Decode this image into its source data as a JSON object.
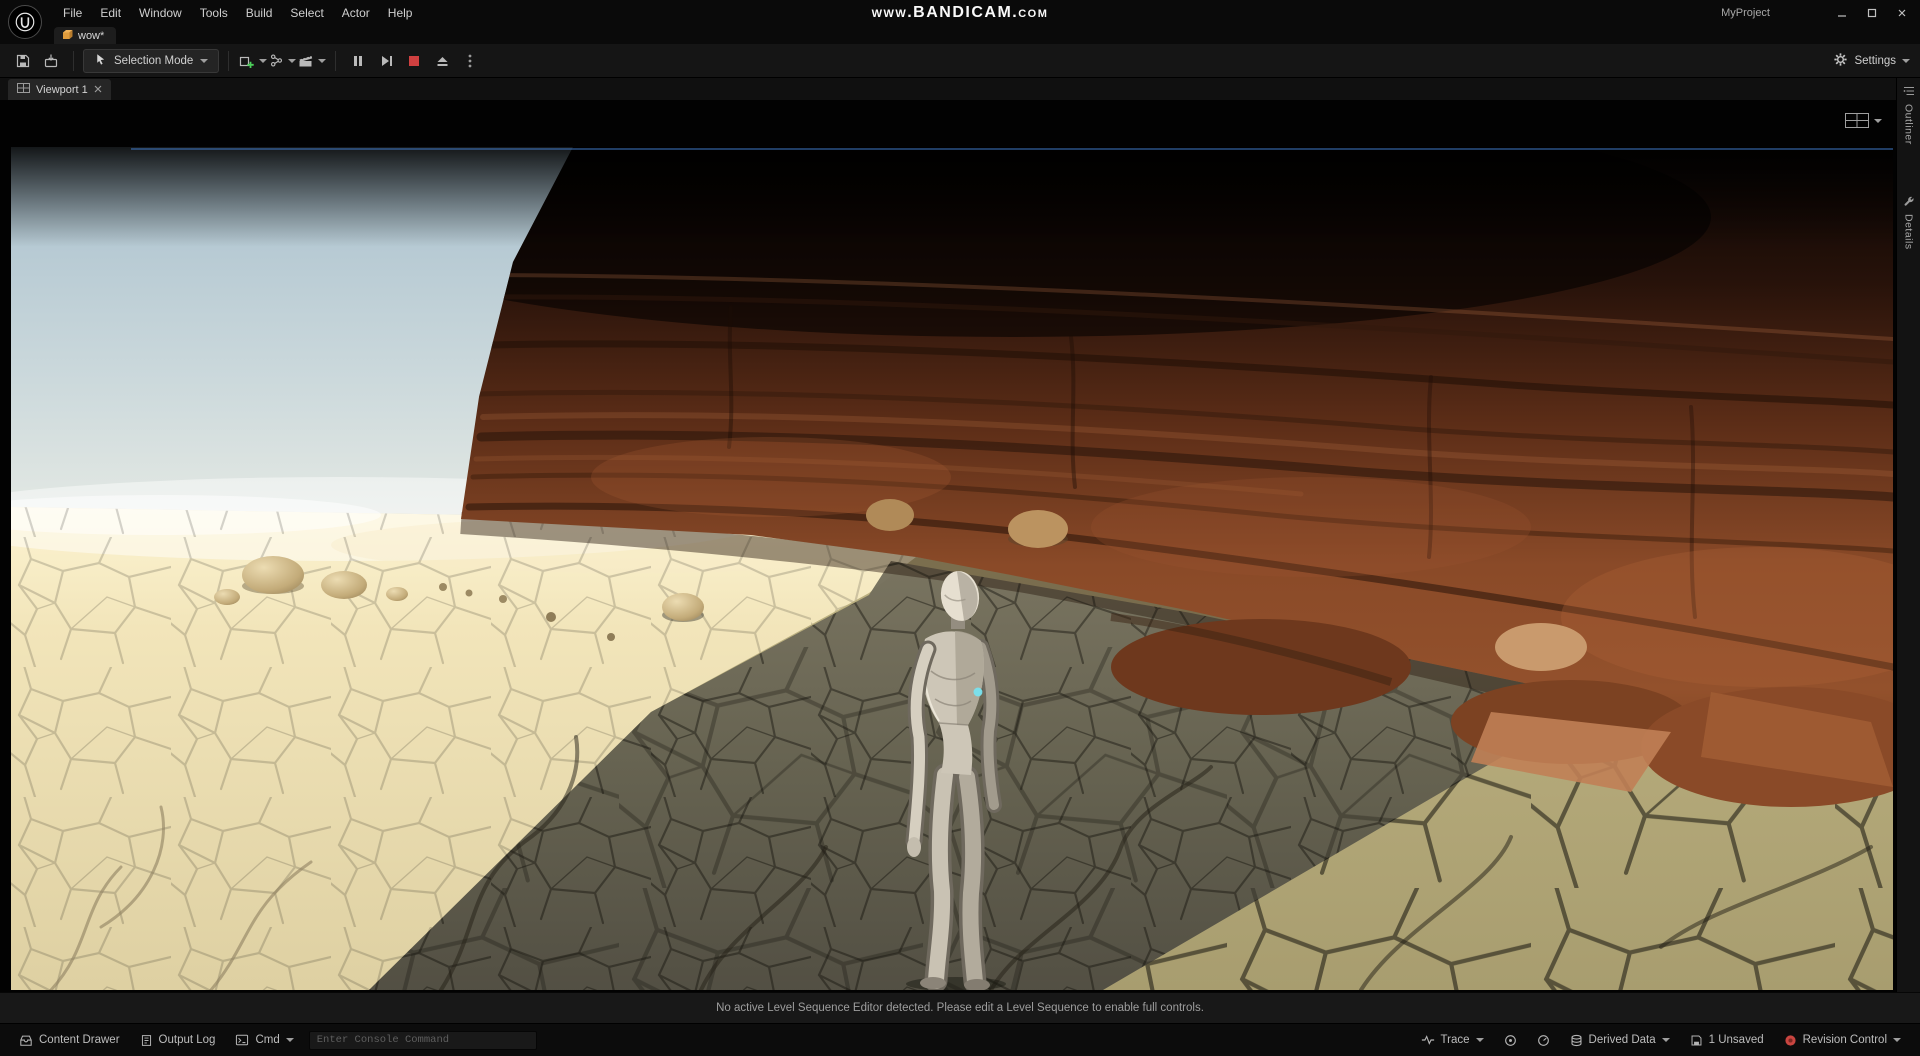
{
  "window": {
    "project": "MyProject",
    "watermark": "www.BANDICAM.com"
  },
  "menubar": {
    "items": [
      "File",
      "Edit",
      "Window",
      "Tools",
      "Build",
      "Select",
      "Actor",
      "Help"
    ]
  },
  "asset_tabs": {
    "active": "wow*"
  },
  "toolbar": {
    "selection_mode_label": "Selection Mode",
    "settings_label": "Settings"
  },
  "viewport": {
    "tab_label": "Viewport 1",
    "overlay_message": "No active Level Sequence Editor detected. Please edit a Level Sequence to enable full controls."
  },
  "right_panel": {
    "tabs": [
      "Outliner",
      "Details"
    ]
  },
  "statusbar": {
    "content_drawer": "Content Drawer",
    "output_log": "Output Log",
    "cmd": "Cmd",
    "console_placeholder": "Enter Console Command",
    "trace": "Trace",
    "derived_data": "Derived Data",
    "unsaved": "1 Unsaved",
    "revision_control": "Revision Control"
  },
  "colors": {
    "accent_orange": "#e09c3c",
    "add_green": "#4ccf5a",
    "stop_red": "#cf4040",
    "revision_red": "#c94540",
    "chest_glow": "#79e2ee"
  }
}
